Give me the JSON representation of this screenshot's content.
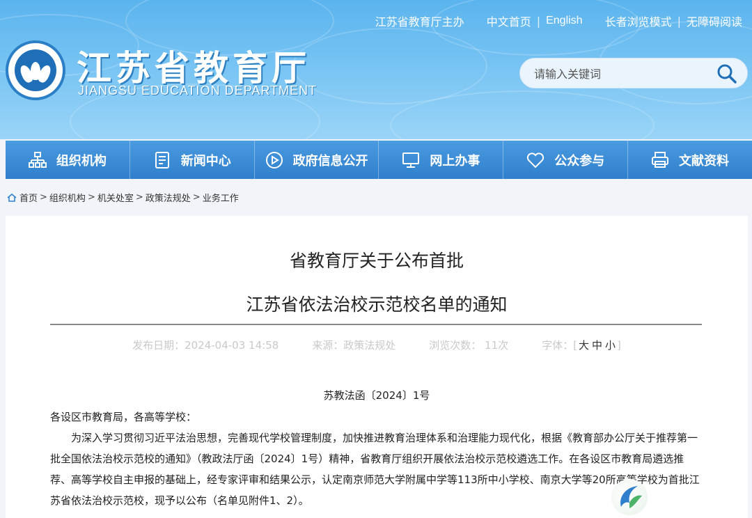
{
  "header": {
    "toplinks": {
      "sponsor": "江苏省教育厅主办",
      "cn_home": "中文首页",
      "english": "English",
      "elder_mode": "长者浏览模式",
      "accessible": "无障碍阅读"
    },
    "logo_cn": "江苏省教育厅",
    "logo_en": "JIANGSU EDUCATION DEPARTMENT",
    "search_placeholder": "请输入关键词"
  },
  "nav": [
    {
      "label": "组织机构",
      "icon": "org-chart-icon"
    },
    {
      "label": "新闻中心",
      "icon": "document-icon"
    },
    {
      "label": "政府信息公开",
      "icon": "play-circle-icon"
    },
    {
      "label": "网上办事",
      "icon": "monitor-icon"
    },
    {
      "label": "公众参与",
      "icon": "heart-icon"
    },
    {
      "label": "文献资料",
      "icon": "printer-icon"
    }
  ],
  "breadcrumb": [
    "首页",
    "组织机构",
    "机关处室",
    "政策法规处",
    "业务工作"
  ],
  "article": {
    "title_line1": "省教育厅关于公布首批",
    "title_line2": "江苏省依法治校示范校名单的通知",
    "publish_date": "发布日期：2024-04-03 14:58",
    "source": "来源：政策法规处",
    "views": "浏览次数： 11次",
    "font_label": "字体：[",
    "font_large": "大",
    "font_medium": "中",
    "font_small": "小",
    "font_close": "]",
    "doc_number": "苏教法函〔2024〕1号",
    "salutation": "各设区市教育局，各高等学校：",
    "body": "为深入学习贯彻习近平法治思想，完善现代学校管理制度，加快推进教育治理体系和治理能力现代化，根据《教育部办公厅关于推荐第一批全国依法治校示范校的通知》（教政法厅函〔2024〕1号）精神，省教育厅组织开展依法治校示范校遴选工作。在各设区市教育局遴选推荐、高等学校自主申报的基础上，经专家评审和结果公示，认定南京师范大学附属中学等113所中小学校、南京大学等20所高等学校为首批江苏省依法治校示范校，现予以公布（名单见附件1、2）。"
  },
  "colors": {
    "header_blue": "#5bb4ee",
    "nav_blue": "#2f7fcc"
  }
}
